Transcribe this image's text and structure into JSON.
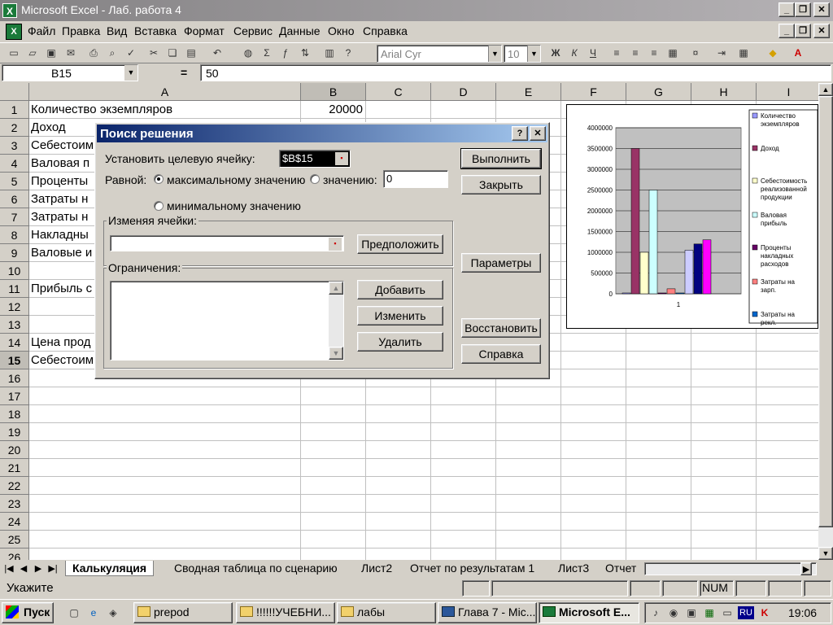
{
  "window": {
    "title": "Microsoft Excel - Лаб. работа 4"
  },
  "menu": [
    "Файл",
    "Правка",
    "Вид",
    "Вставка",
    "Формат",
    "Сервис",
    "Данные",
    "Окно",
    "Справка"
  ],
  "toolbar": {
    "font": "Arial Cyr",
    "size": "10",
    "bold": "Ж",
    "italic": "К",
    "underline": "Ч"
  },
  "formula_bar": {
    "cell": "B15",
    "eq": "=",
    "value": "50"
  },
  "columns": [
    "A",
    "B",
    "C",
    "D",
    "E",
    "F",
    "G",
    "H",
    "I"
  ],
  "rows": [
    "1",
    "2",
    "3",
    "4",
    "5",
    "6",
    "7",
    "8",
    "9",
    "10",
    "11",
    "12",
    "13",
    "14",
    "15",
    "16",
    "17",
    "18",
    "19",
    "20",
    "21",
    "22",
    "23",
    "24",
    "25",
    "26"
  ],
  "cells": {
    "a": [
      "Количество экземпляров",
      "Доход",
      "Себестоим",
      "Валовая п",
      "Проценты",
      "Затраты н",
      "Затраты н",
      "Накладны",
      "Валовые и",
      "",
      "Прибыль с",
      "",
      "",
      "Цена прод",
      "Себестоим"
    ],
    "b1": "20000"
  },
  "dialog": {
    "title": "Поиск решения",
    "help": "?",
    "close": "✕",
    "target_label": "Установить целевую ячейку:",
    "target_value": "$B$15",
    "equal_label": "Равной:",
    "opt_max": "максимальному значению",
    "opt_value": "значению:",
    "value_field": "0",
    "opt_min": "минимальному значению",
    "changing_label": "Изменяя ячейки:",
    "guess": "Предположить",
    "constraints_label": "Ограничения:",
    "add": "Добавить",
    "change": "Изменить",
    "delete": "Удалить",
    "run": "Выполнить",
    "close_btn": "Закрыть",
    "options": "Параметры",
    "reset": "Восстановить",
    "help_btn": "Справка"
  },
  "chart_data": {
    "type": "bar",
    "categories": [
      "1"
    ],
    "ylim": [
      0,
      4000000
    ],
    "yticks": [
      "4000000",
      "3500000",
      "3000000",
      "2500000",
      "2000000",
      "1500000",
      "1000000",
      "500000",
      "0"
    ],
    "series": [
      {
        "name": "Количество экземпляров",
        "values": [
          20000
        ],
        "color": "#9999ff"
      },
      {
        "name": "Доход",
        "values": [
          3500000
        ],
        "color": "#993366"
      },
      {
        "name": "Себестоимость реализованной продукции",
        "values": [
          1000000
        ],
        "color": "#ffffcc"
      },
      {
        "name": "Валовая прибыль",
        "values": [
          2500000
        ],
        "color": "#ccffff"
      },
      {
        "name": "Проценты накладных расходов",
        "values": [
          20000
        ],
        "color": "#660066"
      },
      {
        "name": "Затраты на зарплату",
        "values": [
          120000
        ],
        "color": "#ff8080"
      },
      {
        "name": "Затраты на рекламу",
        "values": [
          20000
        ],
        "color": "#0066cc"
      },
      {
        "name": "",
        "values": [
          1050000
        ],
        "color": "#ccccff"
      },
      {
        "name": "",
        "values": [
          1200000
        ],
        "color": "#000080"
      },
      {
        "name": "",
        "values": [
          1300000
        ],
        "color": "#ff00ff"
      }
    ],
    "legend_labels": [
      "Количество экземпляров",
      "Доход",
      "Себестоимость реализованной продукции",
      "Валовая прибыль",
      "Проценты накладных расходов",
      "Затраты на зарп.",
      "Затраты на рекл."
    ]
  },
  "sheet_tabs": [
    "Калькуляция",
    "Сводная таблица по сценарию",
    "Лист2",
    "Отчет по результатам 1",
    "Лист3",
    "Отчет"
  ],
  "status": {
    "mode": "Укажите",
    "num": "NUM"
  },
  "taskbar": {
    "start": "Пуск",
    "tasks": [
      "prepod",
      "!!!!!!УЧЕБНИ...",
      "лабы",
      "Глава 7 - Mic...",
      "Microsoft E..."
    ],
    "lang": "RU",
    "clock": "19:06"
  }
}
